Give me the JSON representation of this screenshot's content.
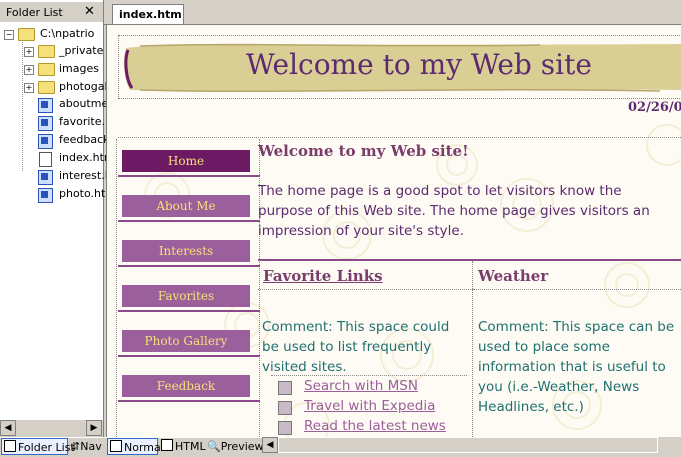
{
  "folder_list": {
    "title": "Folder List",
    "close": "✕",
    "root": "C:\\npatrio",
    "items": [
      {
        "label": "_private",
        "kind": "folder",
        "expandable": true
      },
      {
        "label": "images",
        "kind": "folder",
        "expandable": true
      },
      {
        "label": "photogal",
        "kind": "folder",
        "expandable": true
      },
      {
        "label": "aboutme",
        "kind": "page"
      },
      {
        "label": "favorite.",
        "kind": "page"
      },
      {
        "label": "feedback",
        "kind": "page"
      },
      {
        "label": "index.htr",
        "kind": "text"
      },
      {
        "label": "interest.l",
        "kind": "page"
      },
      {
        "label": "photo.ht",
        "kind": "page"
      }
    ]
  },
  "tabs": {
    "active": "index.htm"
  },
  "page": {
    "banner_title": "Welcome to my Web site",
    "date": "02/26/0",
    "nav": [
      "Home",
      "About Me",
      "Interests",
      "Favorites",
      "Photo Gallery",
      "Feedback"
    ],
    "welcome_heading": "Welcome to my Web site!",
    "welcome_body": "The home page is a good spot to let visitors know the purpose of this Web site. The home page gives visitors an impression of your site's style.",
    "links_heading": "Favorite Links",
    "weather_heading": "Weather",
    "links_comment": "Comment: This space could be used to list frequently visited sites.",
    "weather_comment": "Comment: This space can be used to place some information that is useful to you (i.e.-Weather, News Headlines, etc.)",
    "links": [
      "Search with MSN",
      "Travel with Expedia",
      "Read the latest news"
    ]
  },
  "bottom_bar": {
    "folder_list": "Folder List",
    "nav": "Nav",
    "normal": "Normal",
    "html": "HTML",
    "preview": "Preview"
  },
  "colors": {
    "accent": "#6b1a63",
    "nav_text": "#f4e07a",
    "banner": "#d9cf95",
    "heading": "#7a3c6b",
    "comment": "#207070"
  }
}
